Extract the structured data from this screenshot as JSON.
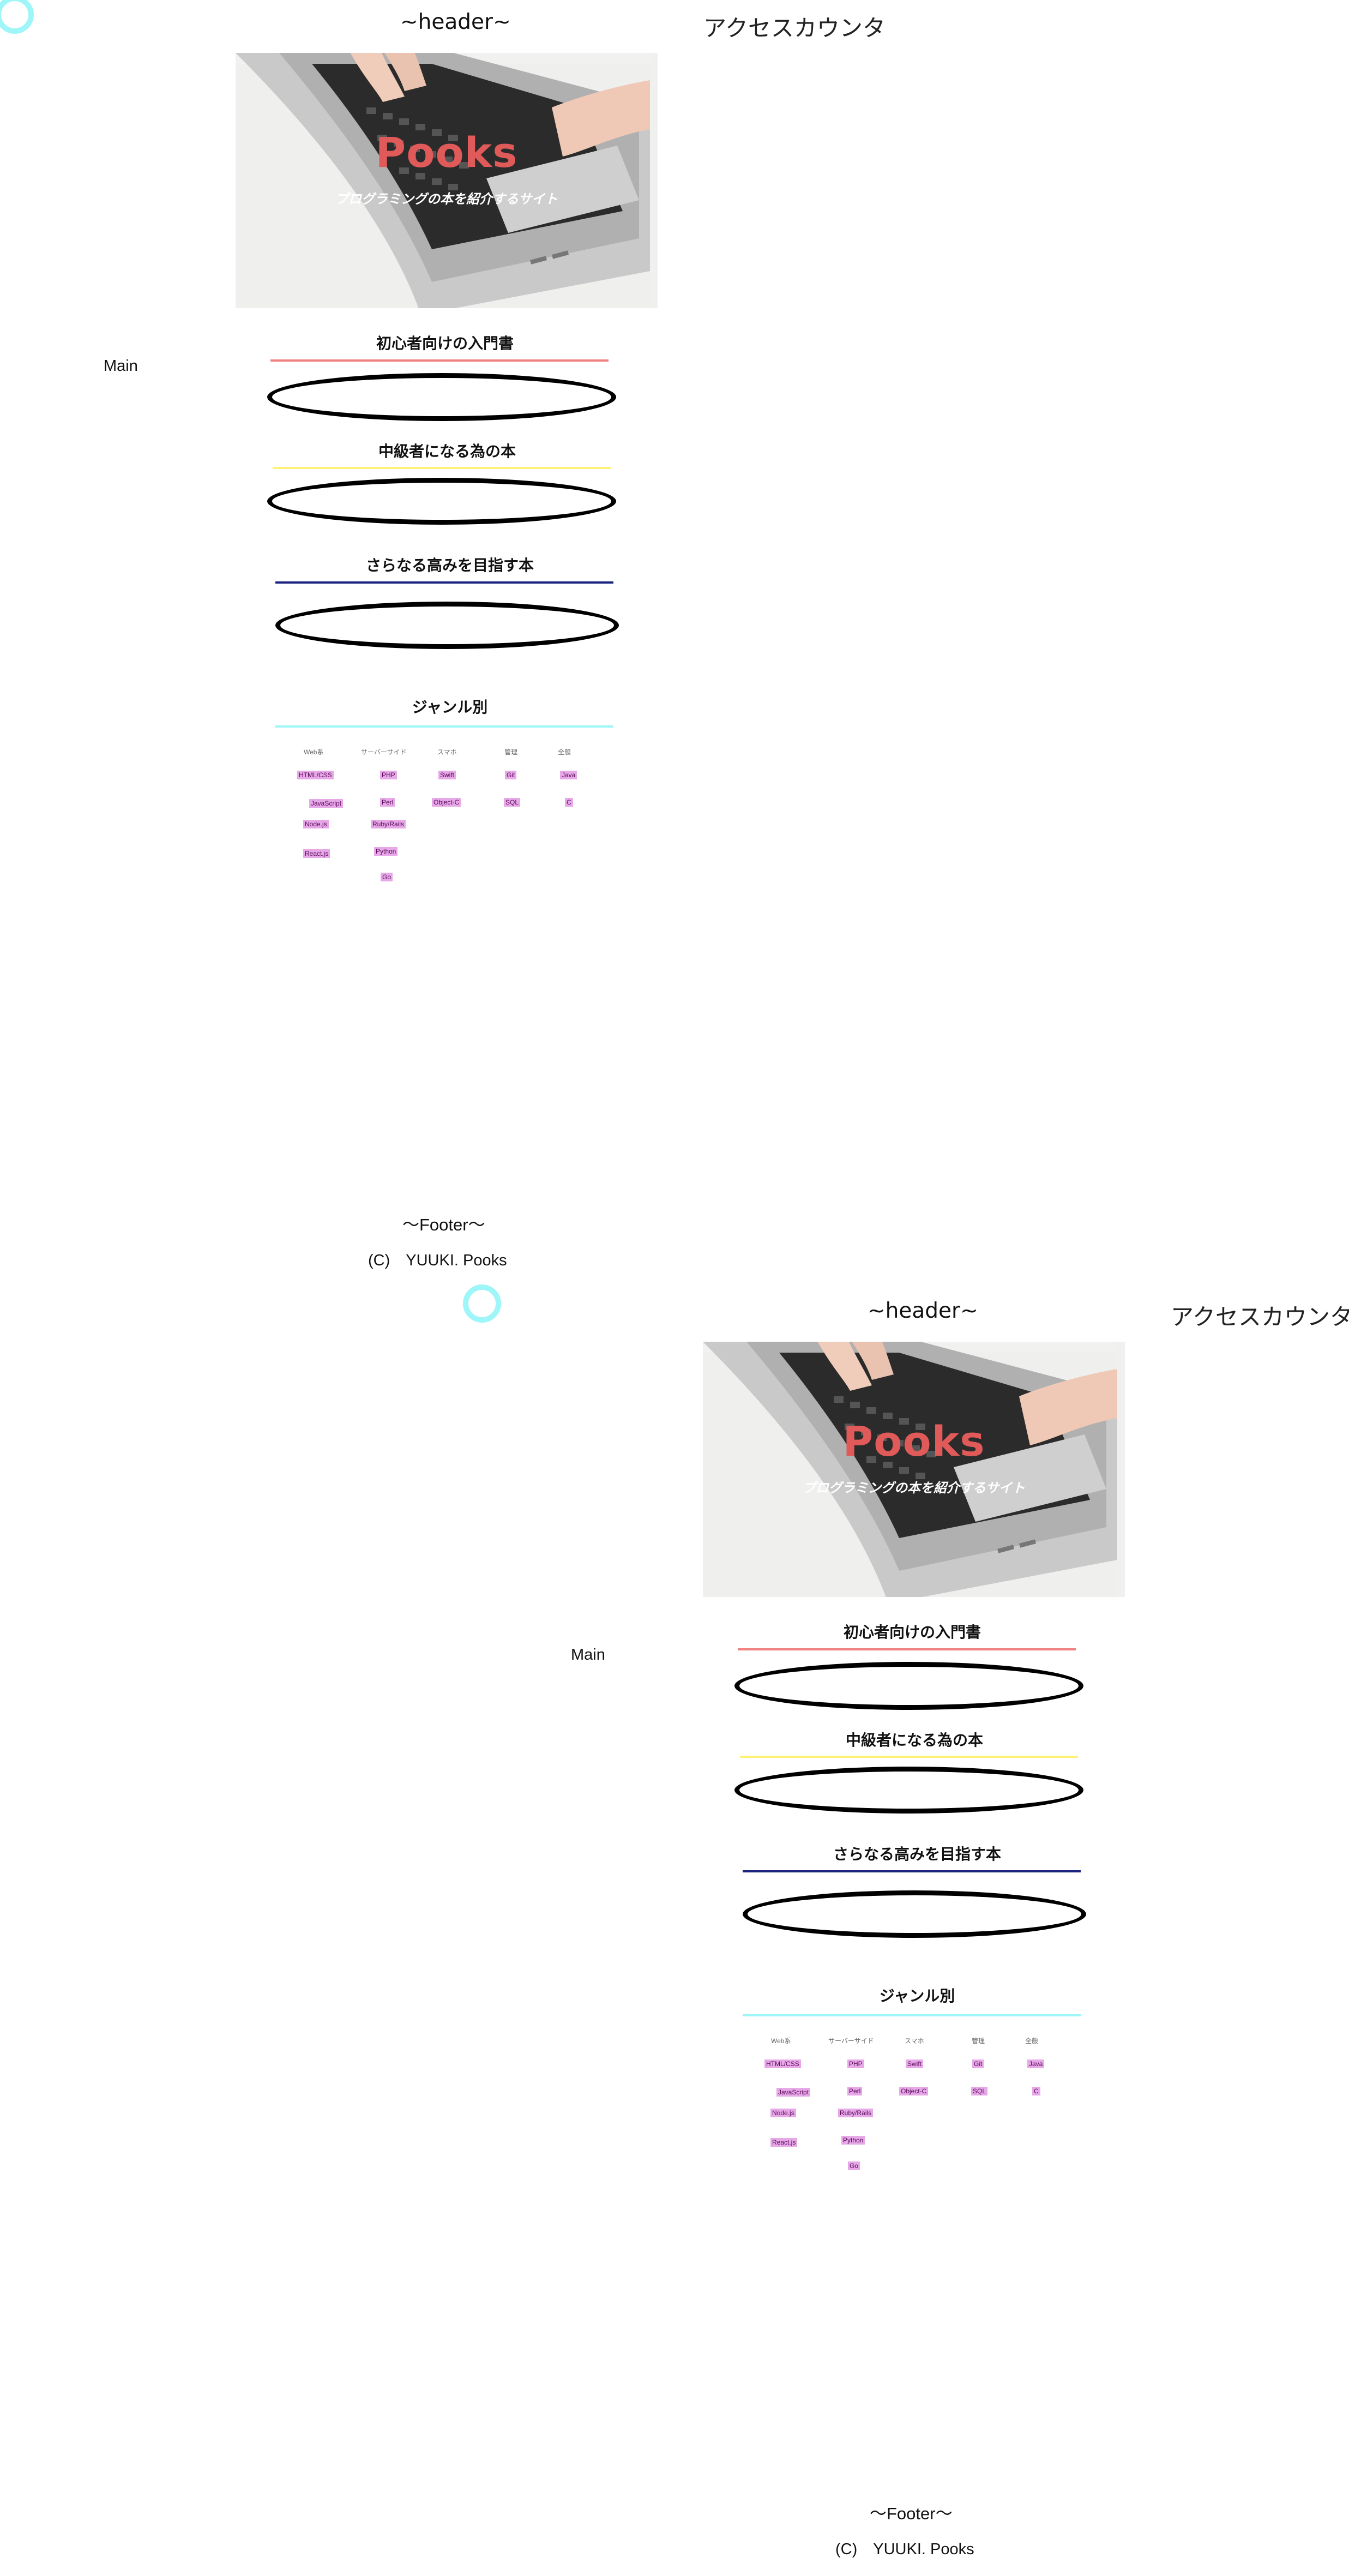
{
  "header": {
    "title": "~header~",
    "access_counter": "アクセスカウンタ"
  },
  "hero": {
    "title": "Pooks",
    "subtitle": "プログラミングの本を紹介するサイト"
  },
  "main": {
    "label": "Main"
  },
  "sections": [
    {
      "title": "初心者向けの入門書",
      "line_color": "#f08080"
    },
    {
      "title": "中級者になる為の本",
      "line_color": "#fff176"
    },
    {
      "title": "さらなる高みを目指す本",
      "line_color": "#1a237e"
    },
    {
      "title": "ジャンル別",
      "line_color": "#9ff6f8"
    }
  ],
  "genres": [
    {
      "heading": "Web系",
      "tags": [
        "HTML/CSS",
        "JavaScript",
        "Node.js",
        "React.js"
      ]
    },
    {
      "heading": "サーバーサイド",
      "tags": [
        "PHP",
        "Perl",
        "Ruby/Rails",
        "Python",
        "Go"
      ]
    },
    {
      "heading": "スマホ",
      "tags": [
        "Swift",
        "Object-C"
      ]
    },
    {
      "heading": "管理",
      "tags": [
        "Git",
        "SQL"
      ]
    },
    {
      "heading": "全般",
      "tags": [
        "Java",
        "C"
      ]
    }
  ],
  "footer": {
    "title": "〜Footer〜",
    "copyright": "(C)　YUUKI. Pooks"
  },
  "colors": {
    "circle": "#9ff6f8",
    "tag_bg": "#e7a8e8",
    "hero_title": "#e05a5a"
  }
}
